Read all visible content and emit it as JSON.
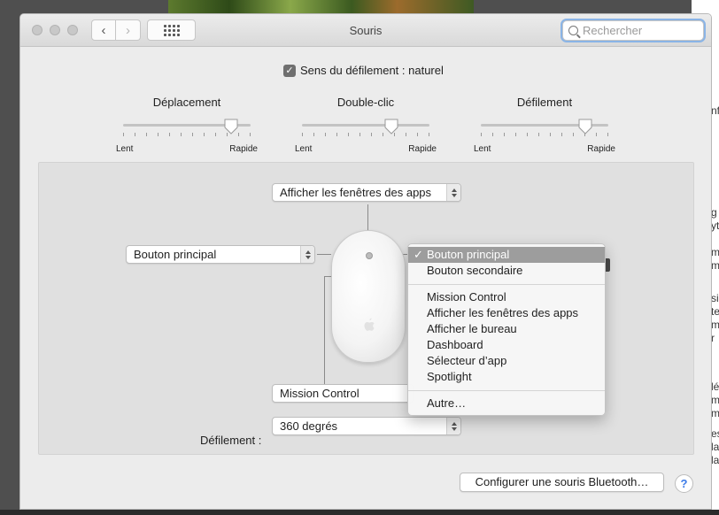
{
  "window": {
    "title": "Souris"
  },
  "search": {
    "placeholder": "Rechercher"
  },
  "scroll_direction": {
    "label": "Sens du défilement : naturel",
    "checked": true
  },
  "sliders": [
    {
      "title": "Déplacement",
      "min_label": "Lent",
      "max_label": "Rapide",
      "value": 0.85
    },
    {
      "title": "Double-clic",
      "min_label": "Lent",
      "max_label": "Rapide",
      "value": 0.7
    },
    {
      "title": "Défilement",
      "min_label": "Lent",
      "max_label": "Rapide",
      "value": 0.82
    }
  ],
  "mouse": {
    "top_popup": "Afficher les fenêtres des apps",
    "left_popup": "Bouton principal",
    "bottom_popup": "Mission Control",
    "scroll_label": "Défilement :",
    "scroll_popup": "360 degrés"
  },
  "menu": {
    "group1": [
      "Bouton principal",
      "Bouton secondaire"
    ],
    "group2": [
      "Mission Control",
      "Afficher les fenêtres des apps",
      "Afficher le bureau",
      "Dashboard",
      "Sélecteur d’app",
      "Spotlight"
    ],
    "group3": [
      "Autre…"
    ],
    "checkmark": "✓"
  },
  "footer": {
    "bluetooth_button": "Configurer une souris Bluetooth…",
    "help": "?"
  },
  "background_doc": [
    "nf",
    "g",
    "yt",
    "m",
    "m",
    "sis",
    "te",
    "m",
    "r",
    "lé",
    "m",
    "m",
    "est",
    "la",
    "la"
  ]
}
